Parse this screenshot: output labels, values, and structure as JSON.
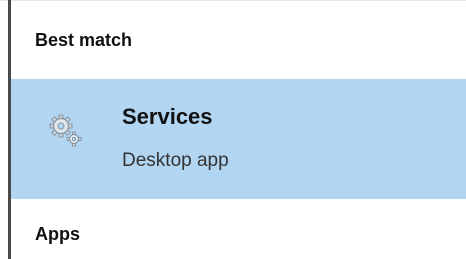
{
  "sections": {
    "best_match": "Best match",
    "apps": "Apps"
  },
  "best_match_result": {
    "title": "Services",
    "subtitle": "Desktop app",
    "icon": "services-gears-icon",
    "highlight_color": "#b2d5f2"
  }
}
